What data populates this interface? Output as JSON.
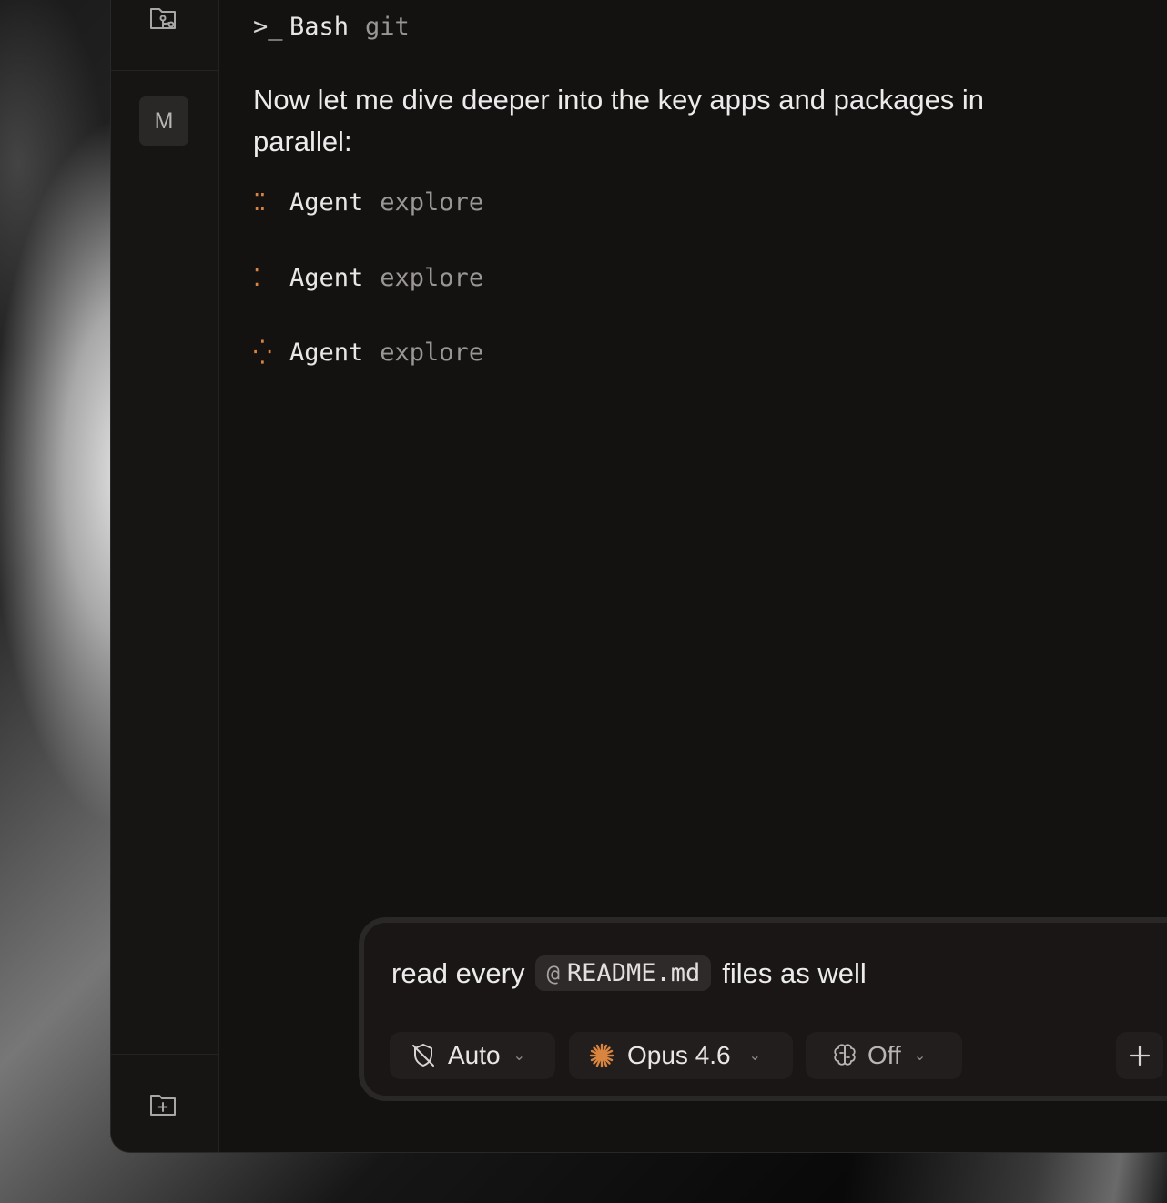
{
  "sidebar": {
    "top_icon": "folder-git-icon",
    "avatar_letter": "M",
    "bottom_icon": "folder-plus-icon"
  },
  "transcript": {
    "bash_tool": {
      "prefix": ">_",
      "name": "Bash",
      "arg": "git"
    },
    "message": "Now let me dive deeper into the key apps and packages in parallel:",
    "agents": [
      {
        "name": "Agent",
        "arg": "explore",
        "spinner": "⁚⁚",
        "spinner_color": "#d9843f"
      },
      {
        "name": "Agent",
        "arg": "explore",
        "spinner": "⁚",
        "spinner_color": "#d9843f"
      },
      {
        "name": "Agent",
        "arg": "explore",
        "spinner": "⁛",
        "spinner_color": "#d9843f"
      }
    ]
  },
  "composer": {
    "text_before": "read every",
    "mention_at": "@",
    "mention_file": "README.md",
    "text_after": "files as well",
    "mode": {
      "label": "Auto",
      "icon": "shield-off-icon"
    },
    "model": {
      "label": "Opus 4.6",
      "icon": "sparkle-icon",
      "accent": "#d9843f"
    },
    "thinking": {
      "label": "Off",
      "icon": "brain-icon"
    },
    "add_icon": "plus-icon",
    "stop_icon": "stop-icon"
  }
}
